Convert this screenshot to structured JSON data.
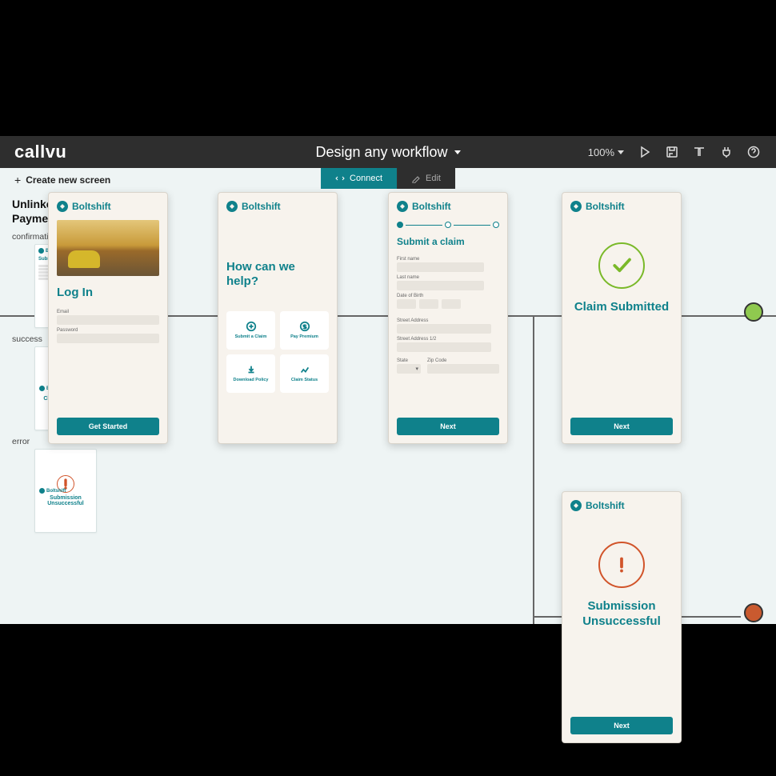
{
  "brand": "callvu",
  "page_title": "Design any workflow",
  "zoom": "100%",
  "toolbar": {
    "create": "Create new screen",
    "tabs": {
      "connect": "Connect",
      "edit": "Edit"
    }
  },
  "side": {
    "heading1": "Unlinked",
    "heading2": "Payment",
    "lbl_confirmation": "confirmation",
    "lbl_success": "success",
    "lbl_error": "error"
  },
  "thumb": {
    "brand": "Boltshift",
    "sub_label": "Submit",
    "claim_submitted": "Claim Submitted",
    "submission_unsuccessful": "Submission Unsuccessful"
  },
  "screen_brand": "Boltshift",
  "s1": {
    "title": "Log In",
    "email": "Email",
    "password": "Password",
    "cta": "Get Started"
  },
  "s2": {
    "title": "How can we help?",
    "tiles": {
      "a": "Submit a Claim",
      "b": "Pay Premium",
      "c": "Download Policy",
      "d": "Claim Status"
    }
  },
  "s3": {
    "title": "Submit a claim",
    "first_name": "First name",
    "last_name": "Last name",
    "dob": "Date of Birth",
    "addr": "Street Address",
    "addr2": "Street Address 1/2",
    "state": "State",
    "zip": "Zip Code",
    "cta": "Next"
  },
  "s4": {
    "title": "Claim Submitted",
    "cta": "Next"
  },
  "s5": {
    "title": "Submission Unsuccessful",
    "cta": "Next"
  }
}
